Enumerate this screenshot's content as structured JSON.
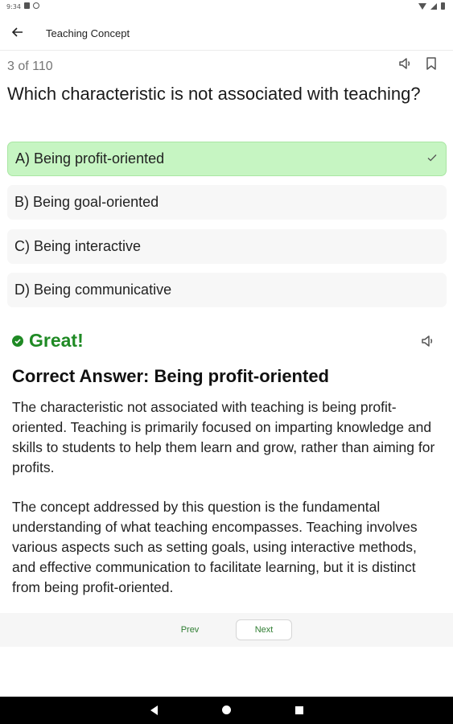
{
  "status_bar": {
    "time": "9:34"
  },
  "app_bar": {
    "title": "Teaching Concept",
    "back_icon": "arrow-left-icon"
  },
  "question": {
    "counter": "3 of 110",
    "text": "Which characteristic is not associated with teaching?",
    "options": [
      {
        "label": "A) Being profit-oriented",
        "state": "correct"
      },
      {
        "label": "B) Being goal-oriented",
        "state": "default"
      },
      {
        "label": "C) Being interactive",
        "state": "default"
      },
      {
        "label": "D) Being communicative",
        "state": "default"
      }
    ]
  },
  "feedback": {
    "status": "Great!",
    "correct_answer": "Correct Answer: Being profit-oriented",
    "explanation_1": "The characteristic not associated with teaching is being profit-oriented. Teaching is primarily focused on imparting knowledge and skills to students to help them learn and grow, rather than aiming for profits.",
    "explanation_2": "The concept addressed by this question is the fundamental understanding of what teaching encompasses. Teaching involves various aspects such as setting goals, using interactive methods, and effective communication to facilitate learning, but it is distinct from being profit-oriented."
  },
  "navigation": {
    "prev": "Prev",
    "next": "Next"
  },
  "colors": {
    "accent_green": "#1f8a24",
    "correct_bg": "#c6f5c2",
    "option_bg": "#f7f7f7"
  }
}
